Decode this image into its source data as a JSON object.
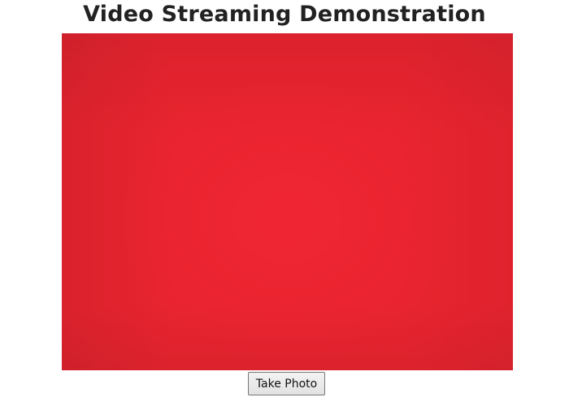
{
  "header": {
    "title": "Video Streaming Demonstration"
  },
  "video": {
    "stream_color": "#e8242f"
  },
  "controls": {
    "take_photo_label": "Take Photo"
  }
}
